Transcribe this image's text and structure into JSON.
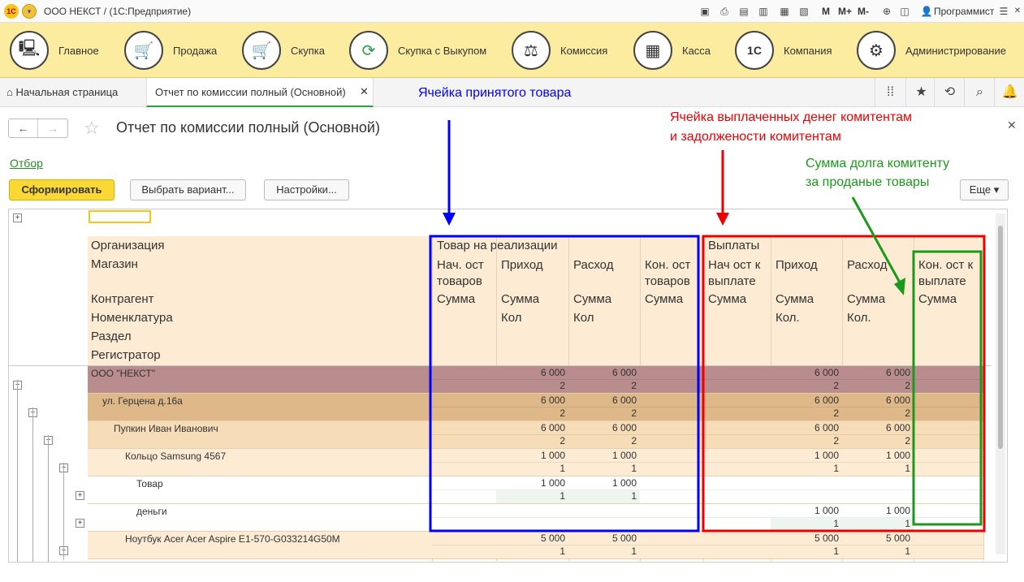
{
  "window": {
    "title": "ООО НЕКСТ /  (1С:Предприятие)",
    "user": "Программист",
    "m_buttons": [
      "M",
      "M+",
      "M-"
    ]
  },
  "sections": [
    {
      "label": "Главное"
    },
    {
      "label": "Продажа"
    },
    {
      "label": "Скупка"
    },
    {
      "label": "Скупка с Выкупом"
    },
    {
      "label": "Комиссия"
    },
    {
      "label": "Касса"
    },
    {
      "label": "Компания"
    },
    {
      "label": "Администрирование"
    }
  ],
  "tabs": {
    "home": "Начальная страница",
    "active": "Отчет по комиссии полный (Основной)"
  },
  "page": {
    "title": "Отчет по комиссии полный (Основной)",
    "filter_link": "Отбор",
    "buttons": {
      "generate": "Сформировать",
      "choose_variant": "Выбрать вариант...",
      "settings": "Настройки...",
      "more": "Еще"
    }
  },
  "report": {
    "row_headers": [
      "Организация",
      "Магазин",
      "Контрагент",
      "Номенклатура",
      "Раздел",
      "Регистратор"
    ],
    "group1": "Товар на реализации",
    "group2": "Выплаты",
    "cols": [
      {
        "h": "Нач. ост\nтоваров",
        "m": "Сумма",
        "k": ""
      },
      {
        "h": "Приход",
        "m": "Сумма",
        "k": "Кол"
      },
      {
        "h": "Расход",
        "m": "Сумма",
        "k": "Кол"
      },
      {
        "h": "Кон. ост\nтоваров",
        "m": "Сумма",
        "k": ""
      },
      {
        "h": "Нач ост к\nвыплате",
        "m": "Сумма",
        "k": ""
      },
      {
        "h": "Приход",
        "m": "Сумма",
        "k": "Кол."
      },
      {
        "h": "Расход",
        "m": "Сумма",
        "k": "Кол."
      },
      {
        "h": "Кон. ост к\nвыплате",
        "m": "Сумма",
        "k": ""
      }
    ],
    "rows": [
      {
        "label": "ООО \"НЕКСТ\"",
        "level": 0,
        "top": [
          "",
          "6 000",
          "6 000",
          "",
          "",
          "6 000",
          "6 000",
          ""
        ],
        "bottom": [
          "",
          "2",
          "2",
          "",
          "",
          "2",
          "2",
          ""
        ]
      },
      {
        "label": "ул. Герцена д.16а",
        "level": 1,
        "top": [
          "",
          "6 000",
          "6 000",
          "",
          "",
          "6 000",
          "6 000",
          ""
        ],
        "bottom": [
          "",
          "2",
          "2",
          "",
          "",
          "2",
          "2",
          ""
        ]
      },
      {
        "label": "Пупкин Иван Иванович",
        "level": 2,
        "top": [
          "",
          "6 000",
          "6 000",
          "",
          "",
          "6 000",
          "6 000",
          ""
        ],
        "bottom": [
          "",
          "2",
          "2",
          "",
          "",
          "2",
          "2",
          ""
        ]
      },
      {
        "label": "Кольцо Samsung 4567",
        "level": 3,
        "top": [
          "",
          "1 000",
          "1 000",
          "",
          "",
          "1 000",
          "1 000",
          ""
        ],
        "bottom": [
          "",
          "1",
          "1",
          "",
          "",
          "1",
          "1",
          ""
        ]
      },
      {
        "label": "Товар",
        "level": 4,
        "top": [
          "",
          "1 000",
          "1 000",
          "",
          "",
          "",
          "",
          ""
        ],
        "bottom": [
          "",
          "1",
          "1",
          "",
          "",
          "",
          "",
          ""
        ]
      },
      {
        "label": "деньги",
        "level": 4,
        "top": [
          "",
          "",
          "",
          "",
          "",
          "1 000",
          "1 000",
          ""
        ],
        "bottom": [
          "",
          "",
          "",
          "",
          "",
          "1",
          "1",
          ""
        ]
      },
      {
        "label": "Ноутбук Acer Acer Aspire E1-570-G033214G50M",
        "level": 3,
        "top": [
          "",
          "5 000",
          "5 000",
          "",
          "",
          "5 000",
          "5 000",
          ""
        ],
        "bottom": [
          "",
          "1",
          "1",
          "",
          "",
          "1",
          "1",
          ""
        ]
      }
    ]
  },
  "annotations": {
    "blue": "Ячейка принятого товара",
    "red_line1": "Ячейка выплаченных денег комитентам",
    "red_line2": "и задолжености комитентам",
    "green_line1": "Сумма долга комитенту",
    "green_line2": "за проданые товары"
  },
  "colors": {
    "section_bg": "#fbeca0",
    "level0": "#b98d8d",
    "level1": "#dfb889",
    "level2": "#f7dcb8",
    "level3": "#fdebd3",
    "level4": "#ffffff",
    "header": "#fdebd3",
    "blue": "#0000ff",
    "red": "#ee0000",
    "green": "#1a9a1a"
  }
}
